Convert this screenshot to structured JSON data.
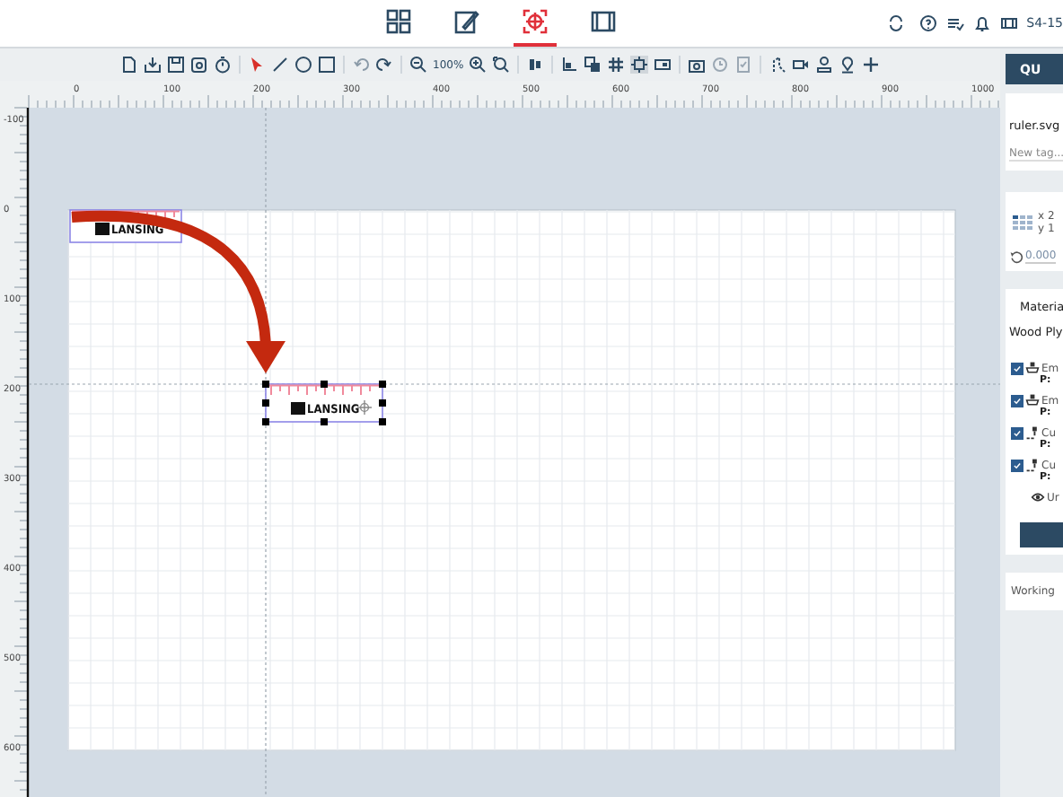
{
  "mode_tabs": [
    {
      "kind": "grid",
      "selected": false
    },
    {
      "kind": "edit",
      "selected": false
    },
    {
      "kind": "target",
      "selected": true
    },
    {
      "kind": "film",
      "selected": false
    }
  ],
  "machine": {
    "name": "S4-15"
  },
  "toolbar": {
    "zoom": "100%"
  },
  "rulers": {
    "horizontal": [
      "0",
      "100",
      "200",
      "300",
      "400",
      "500",
      "600",
      "700",
      "800",
      "900",
      "1000"
    ],
    "vertical": [
      "-100",
      "0",
      "100",
      "200",
      "300",
      "400",
      "500",
      "600"
    ]
  },
  "canvas": {
    "objects": [
      {
        "label": "LANSING",
        "selected": false
      },
      {
        "label": "LANSING",
        "selected": true
      }
    ]
  },
  "panel": {
    "quick_button": "QU",
    "file_name": "ruler.svg",
    "tag_placeholder": "New tag...",
    "position": {
      "x": "x 2",
      "y": "y 1"
    },
    "rotation": "0.000",
    "material_label": "Materia",
    "material_value": "Wood Ply",
    "layers": [
      {
        "kind": "engrave",
        "name": "Em",
        "power": "P:",
        "checked": true
      },
      {
        "kind": "engrave",
        "name": "Em",
        "power": "P:",
        "checked": true
      },
      {
        "kind": "cut",
        "name": "Cu",
        "power": "P:",
        "checked": true
      },
      {
        "kind": "cut",
        "name": "Cu",
        "power": "P:",
        "checked": true
      }
    ],
    "visibility_label": "Ur",
    "working": "Working"
  }
}
